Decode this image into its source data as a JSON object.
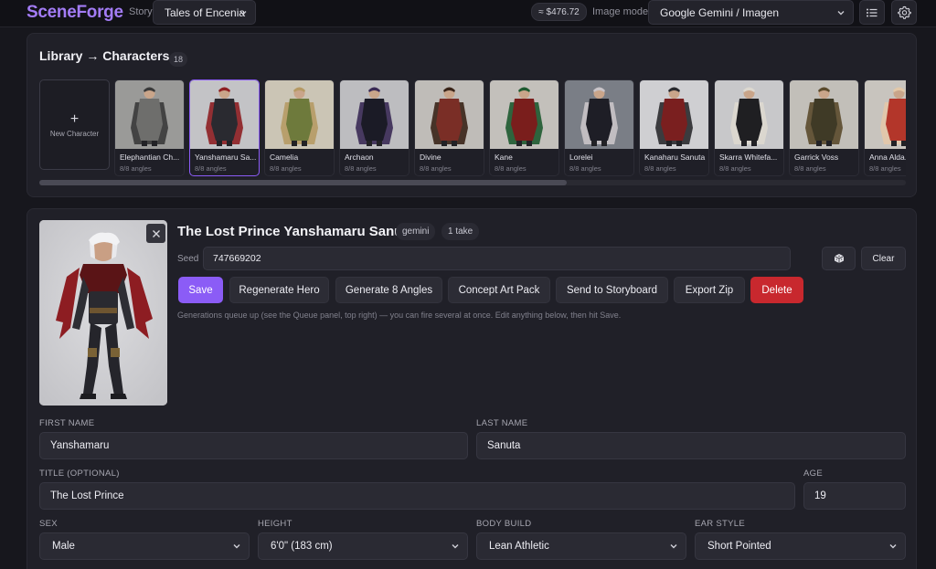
{
  "app": {
    "name": "SceneForge"
  },
  "topbar": {
    "story_label": "Story",
    "story_value": "Tales of Encenia",
    "cost": "≈ $476.72",
    "model_label": "Image model",
    "model_value": "Google Gemini / Imagen",
    "icons": [
      "list-icon",
      "gear-icon"
    ]
  },
  "library": {
    "title": "Library → Characters",
    "count": "18",
    "new_character_label": "New Character",
    "characters": [
      {
        "name": "Elephantian Ch...",
        "angles": "8/8 angles",
        "palette": [
          "#9a9a98",
          "#6e6e6c",
          "#3a3a3a"
        ]
      },
      {
        "name": "Yanshamaru Sa...",
        "angles": "8/8 angles",
        "palette": [
          "#c3c3c6",
          "#2a2a30",
          "#8e1f22"
        ]
      },
      {
        "name": "Camelia",
        "angles": "8/8 angles",
        "palette": [
          "#cbc5b5",
          "#6e7a3c",
          "#b69a64"
        ]
      },
      {
        "name": "Archaon",
        "angles": "8/8 angles",
        "palette": [
          "#bdbdc0",
          "#1b1b26",
          "#3a2a55"
        ]
      },
      {
        "name": "Divine",
        "angles": "8/8 angles",
        "palette": [
          "#bfbcb8",
          "#7a2e26",
          "#3a2418"
        ]
      },
      {
        "name": "Kane",
        "angles": "8/8 angles",
        "palette": [
          "#c3c0bb",
          "#7a1e1c",
          "#1e5a30"
        ]
      },
      {
        "name": "Lorelei",
        "angles": "8/8 angles",
        "palette": [
          "#7a7e86",
          "#1e1e26",
          "#c9c4c8"
        ]
      },
      {
        "name": "Kanaharu Sanuta",
        "angles": "8/8 angles",
        "palette": [
          "#cfcfd2",
          "#7a1f1f",
          "#2a2a2e"
        ]
      },
      {
        "name": "Skarra Whitefa...",
        "angles": "8/8 angles",
        "palette": [
          "#c8c8ca",
          "#1f1f22",
          "#ddd8cf"
        ]
      },
      {
        "name": "Garrick Voss",
        "angles": "8/8 angles",
        "palette": [
          "#c2bfb9",
          "#3f3a26",
          "#5b4a2c"
        ]
      },
      {
        "name": "Anna Alda...",
        "angles": "8/8 angles",
        "palette": [
          "#c8c4be",
          "#b3362a",
          "#e3c8a8"
        ]
      }
    ]
  },
  "character": {
    "title": "The Lost Prince Yanshamaru Sanuta",
    "engine_tag": "gemini",
    "takes_tag": "1 take",
    "seed_label": "Seed",
    "seed_value": "747669202",
    "clear_label": "Clear",
    "buttons": {
      "save": "Save",
      "regenerate": "Regenerate Hero",
      "angles": "Generate 8 Angles",
      "concept": "Concept Art Pack",
      "storyboard": "Send to Storyboard",
      "export": "Export Zip",
      "delete": "Delete"
    },
    "hint": "Generations queue up (see the Queue panel, top right) — you can fire several at once. Edit anything below, then hit Save.",
    "fields": {
      "first_name_label": "FIRST NAME",
      "first_name": "Yanshamaru",
      "last_name_label": "LAST NAME",
      "last_name": "Sanuta",
      "title_label": "TITLE (OPTIONAL)",
      "title": "The Lost Prince",
      "age_label": "AGE",
      "age": "19",
      "sex_label": "SEX",
      "sex": "Male",
      "height_label": "HEIGHT",
      "height": "6'0\" (183 cm)",
      "build_label": "BODY BUILD",
      "build": "Lean Athletic",
      "ear_label": "EAR STYLE",
      "ear": "Short Pointed"
    }
  },
  "colors": {
    "accent": "#8b5cf6",
    "danger": "#c8282e",
    "logo": "#a37cf6",
    "bg": "#17171d",
    "panel": "#202028"
  }
}
